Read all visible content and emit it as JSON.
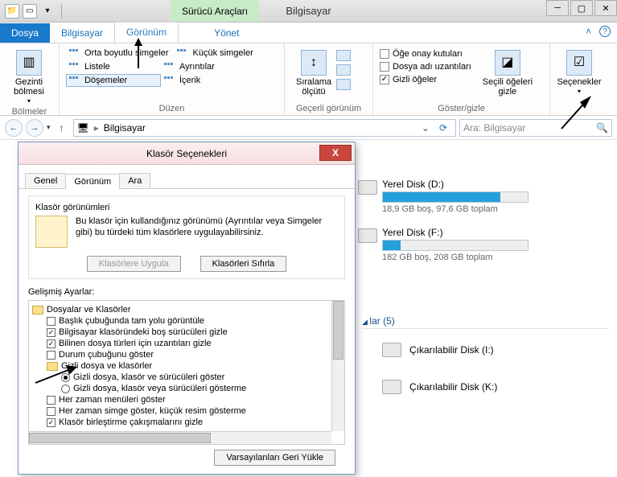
{
  "titlebar": {
    "driveTools": "Sürücü Araçları",
    "windowTitle": "Bilgisayar"
  },
  "tabs": {
    "file": "Dosya",
    "computer": "Bilgisayar",
    "view": "Görünüm",
    "manage": "Yönet"
  },
  "ribbon": {
    "panes": {
      "nav": "Gezinti\nbölmesi",
      "group": "Bölmeler"
    },
    "layout": {
      "mediumIcons": "Orta boyutlu simgeler",
      "smallIcons": "Küçük simgeler",
      "list": "Listele",
      "details": "Ayrıntılar",
      "tiles": "Döşemeler",
      "content": "İçerik",
      "group": "Düzen"
    },
    "currentView": {
      "sort": "Sıralama\nölçütü",
      "group": "Geçerli görünüm"
    },
    "showHide": {
      "itemCheck": "Öğe onay kutuları",
      "fileExt": "Dosya adı uzantıları",
      "hiddenItems": "Gizli öğeler",
      "hideSelected": "Seçili öğeleri\ngizle",
      "group": "Göster/gizle"
    },
    "options": {
      "label": "Seçenekler"
    }
  },
  "address": {
    "path": "Bilgisayar",
    "searchPlaceholder": "Ara: Bilgisayar"
  },
  "drives": {
    "d": {
      "name": "Yerel Disk (D:)",
      "info": "18,9 GB boş, 97,6 GB toplam",
      "fillPct": 81
    },
    "f": {
      "name": "Yerel Disk (F:)",
      "info": "182 GB boş, 208 GB toplam",
      "fillPct": 12
    },
    "removableSection": "lar (5)",
    "i": "Çıkarılabilir Disk (I:)",
    "k": "Çıkarılabilir Disk (K:)"
  },
  "dialog": {
    "title": "Klasör Seçenekleri",
    "tabs": {
      "general": "Genel",
      "view": "Görünüm",
      "search": "Ara"
    },
    "folderViews": {
      "header": "Klasör görünümleri",
      "desc": "Bu klasör için kullandığınız görünümü (Ayrıntılar veya Simgeler gibi) bu türdeki tüm klasörlere uygulayabilirsiniz.",
      "applyBtn": "Klasörlere Uygula",
      "resetBtn": "Klasörleri Sıfırla"
    },
    "advancedLabel": "Gelişmiş Ayarlar:",
    "tree": {
      "filesFolders": "Dosyalar ve Klasörler",
      "fullPath": "Başlık çubuğunda tam yolu görüntüle",
      "hideEmpty": "Bilgisayar klasöründeki boş sürücüleri gizle",
      "hideExt": "Bilinen dosya türleri için uzantıları gizle",
      "statusBar": "Durum çubuğunu göster",
      "hiddenGroup": "Gizli dosya ve klasörler",
      "showHidden": "Gizli dosya, klasör ve sürücüleri göster",
      "dontShowHidden": "Gizli dosya, klasör veya sürücüleri gösterme",
      "alwaysMenus": "Her zaman menüleri göster",
      "alwaysIcons": "Her zaman simge göster, küçük resim gösterme",
      "mergeConflicts": "Klasör birleştirme çakışmalarını gizle"
    },
    "restoreDefaults": "Varsayılanları Geri Yükle"
  }
}
